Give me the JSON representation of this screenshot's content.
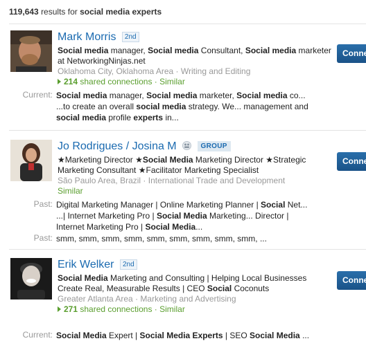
{
  "summary": {
    "count": "119,643",
    "text": "results for",
    "query": "social media experts"
  },
  "results": [
    {
      "name": "Mark Morris",
      "degree": "2nd",
      "headline_parts": [
        [
          "b",
          "Social media"
        ],
        [
          "t",
          " manager, "
        ],
        [
          "b",
          "Social media"
        ],
        [
          "t",
          " Consultant, "
        ],
        [
          "b",
          "Social media"
        ],
        [
          "t",
          " marketer at NetworkingNinjas.net"
        ]
      ],
      "location": "Oklahoma City, Oklahoma Area",
      "industry": "Writing and Editing",
      "shared_count": "214",
      "shared_label": "shared connections",
      "similar": "Similar",
      "detail_label": "Current:",
      "detail_parts": [
        [
          "b",
          "Social media"
        ],
        [
          "t",
          " manager, "
        ],
        [
          "b",
          "Social media"
        ],
        [
          "t",
          " marketer, "
        ],
        [
          "b",
          "Social media"
        ],
        [
          "t",
          " co...\n...to create an overall "
        ],
        [
          "b",
          "social media"
        ],
        [
          "t",
          " strategy. We... management and "
        ],
        [
          "b",
          "social media"
        ],
        [
          "t",
          " profile "
        ],
        [
          "b",
          "experts"
        ],
        [
          "t",
          " in..."
        ]
      ],
      "button": "Connect"
    },
    {
      "name": "Jo Rodrigues / Josina M",
      "group_badge": "GROUP",
      "headline_parts": [
        [
          "t",
          "★Marketing Director ★"
        ],
        [
          "b",
          "Social Media"
        ],
        [
          "t",
          " Marketing Director ★Strategic Marketing Consultant ★Facilitator Marketing Specialist"
        ]
      ],
      "location": "São Paulo Area, Brazil",
      "industry": "International Trade and Development",
      "similar": "Similar",
      "detail_label": "Past:",
      "detail_parts": [
        [
          "t",
          "Digital Marketing Manager | Online Marketing Planner | "
        ],
        [
          "b",
          "Social"
        ],
        [
          "t",
          " Net...\n...| Internet Marketing Pro | "
        ],
        [
          "b",
          "Social Media"
        ],
        [
          "t",
          " Marketing... Director | Internet Marketing Pro | "
        ],
        [
          "b",
          "Social Media"
        ],
        [
          "t",
          "..."
        ]
      ],
      "detail2_label": "Past:",
      "detail2_text": "smm, smm, smm, smm, smm, smm, smm, smm, smm, ...",
      "button": "Connect"
    },
    {
      "name": "Erik Welker",
      "degree": "2nd",
      "headline_parts": [
        [
          "b",
          "Social Media"
        ],
        [
          "t",
          " Marketing and Consulting | Helping Local Businesses Create Real, Measurable Results | CEO "
        ],
        [
          "b",
          "Social"
        ],
        [
          "t",
          " Coconuts"
        ]
      ],
      "location": "Greater Atlanta Area",
      "industry": "Marketing and Advertising",
      "shared_count": "271",
      "shared_label": "shared connections",
      "similar": "Similar",
      "detail_label": "Current:",
      "detail_parts": [
        [
          "b",
          "Social Media"
        ],
        [
          "t",
          " Expert | "
        ],
        [
          "b",
          "Social Media Experts"
        ],
        [
          "t",
          " | SEO "
        ],
        [
          "b",
          "Social Media"
        ],
        [
          "t",
          " ..."
        ]
      ],
      "button": "Connect"
    }
  ],
  "meta_separator": "·",
  "colors": {
    "link": "#1a6ab0",
    "button": "#1f5c93",
    "connections": "#5a9e2e",
    "muted": "#999999"
  }
}
